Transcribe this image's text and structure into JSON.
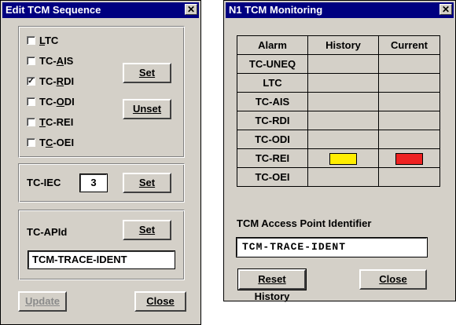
{
  "edit": {
    "title": "Edit TCM Sequence",
    "checks": [
      {
        "pre": "",
        "u": "L",
        "post": "TC",
        "checked": false
      },
      {
        "pre": "TC-",
        "u": "A",
        "post": "IS",
        "checked": false
      },
      {
        "pre": "TC-",
        "u": "R",
        "post": "DI",
        "checked": true
      },
      {
        "pre": "TC-",
        "u": "O",
        "post": "DI",
        "checked": false
      },
      {
        "pre": "",
        "u": "T",
        "post": "C-REI",
        "checked": false
      },
      {
        "pre": "T",
        "u": "C",
        "post": "-OEI",
        "checked": false
      }
    ],
    "set_label": "Set",
    "unset_label": "Unset",
    "iec_label": "TC-IEC",
    "iec_value": "3",
    "iec_set_label": "Set",
    "apid_label": "TC-APId",
    "apid_set_label": "Set",
    "apid_value": "TCM-TRACE-IDENT",
    "update_label": "Update",
    "close_label": "Close"
  },
  "monitor": {
    "title": "N1 TCM Monitoring",
    "columns": [
      "Alarm",
      "History",
      "Current"
    ],
    "rows": [
      {
        "alarm": "TC-UNEQ",
        "history": "",
        "current": ""
      },
      {
        "alarm": "LTC",
        "history": "",
        "current": ""
      },
      {
        "alarm": "TC-AIS",
        "history": "",
        "current": ""
      },
      {
        "alarm": "TC-RDI",
        "history": "",
        "current": ""
      },
      {
        "alarm": "TC-ODI",
        "history": "",
        "current": ""
      },
      {
        "alarm": "TC-REI",
        "history": "yellow",
        "current": "red"
      },
      {
        "alarm": "TC-OEI",
        "history": "",
        "current": ""
      }
    ],
    "indicator_colors": {
      "yellow": "#ffee00",
      "red": "#ee2222"
    },
    "api_label": "TCM Access Point Identifier",
    "api_value": "TCM-TRACE-IDENT",
    "reset_label": "Reset History",
    "close_label": "Close"
  }
}
